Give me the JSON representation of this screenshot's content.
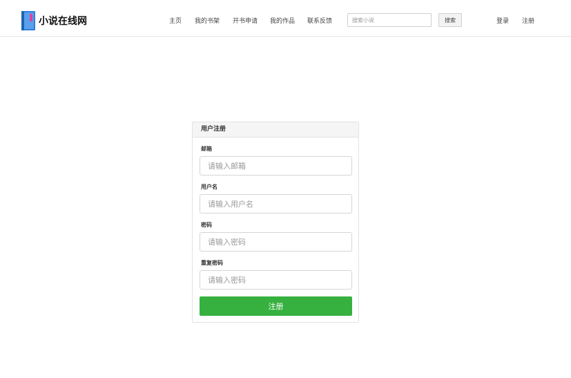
{
  "brand": {
    "name": "小说在线网",
    "icon": "book-icon"
  },
  "nav": {
    "items": [
      {
        "label": "主页"
      },
      {
        "label": "我的书架"
      },
      {
        "label": "开书申请"
      },
      {
        "label": "我的作品"
      },
      {
        "label": "联系反馈"
      }
    ]
  },
  "search": {
    "placeholder": "搜索小说",
    "value": "",
    "button_label": "搜索"
  },
  "auth": {
    "login": "登录",
    "register": "注册"
  },
  "form": {
    "title": "用户注册",
    "fields": [
      {
        "label": "邮箱",
        "placeholder": "请输入邮箱",
        "value": ""
      },
      {
        "label": "用户名",
        "placeholder": "请输入用户名",
        "value": ""
      },
      {
        "label": "密码",
        "placeholder": "请输入密码",
        "value": ""
      },
      {
        "label": "重复密码",
        "placeholder": "请输入密码",
        "value": ""
      }
    ],
    "submit_label": "注册"
  },
  "colors": {
    "accent": "#36b13f",
    "logo_blue": "#2f7fd8",
    "logo_pink": "#e0439b"
  }
}
